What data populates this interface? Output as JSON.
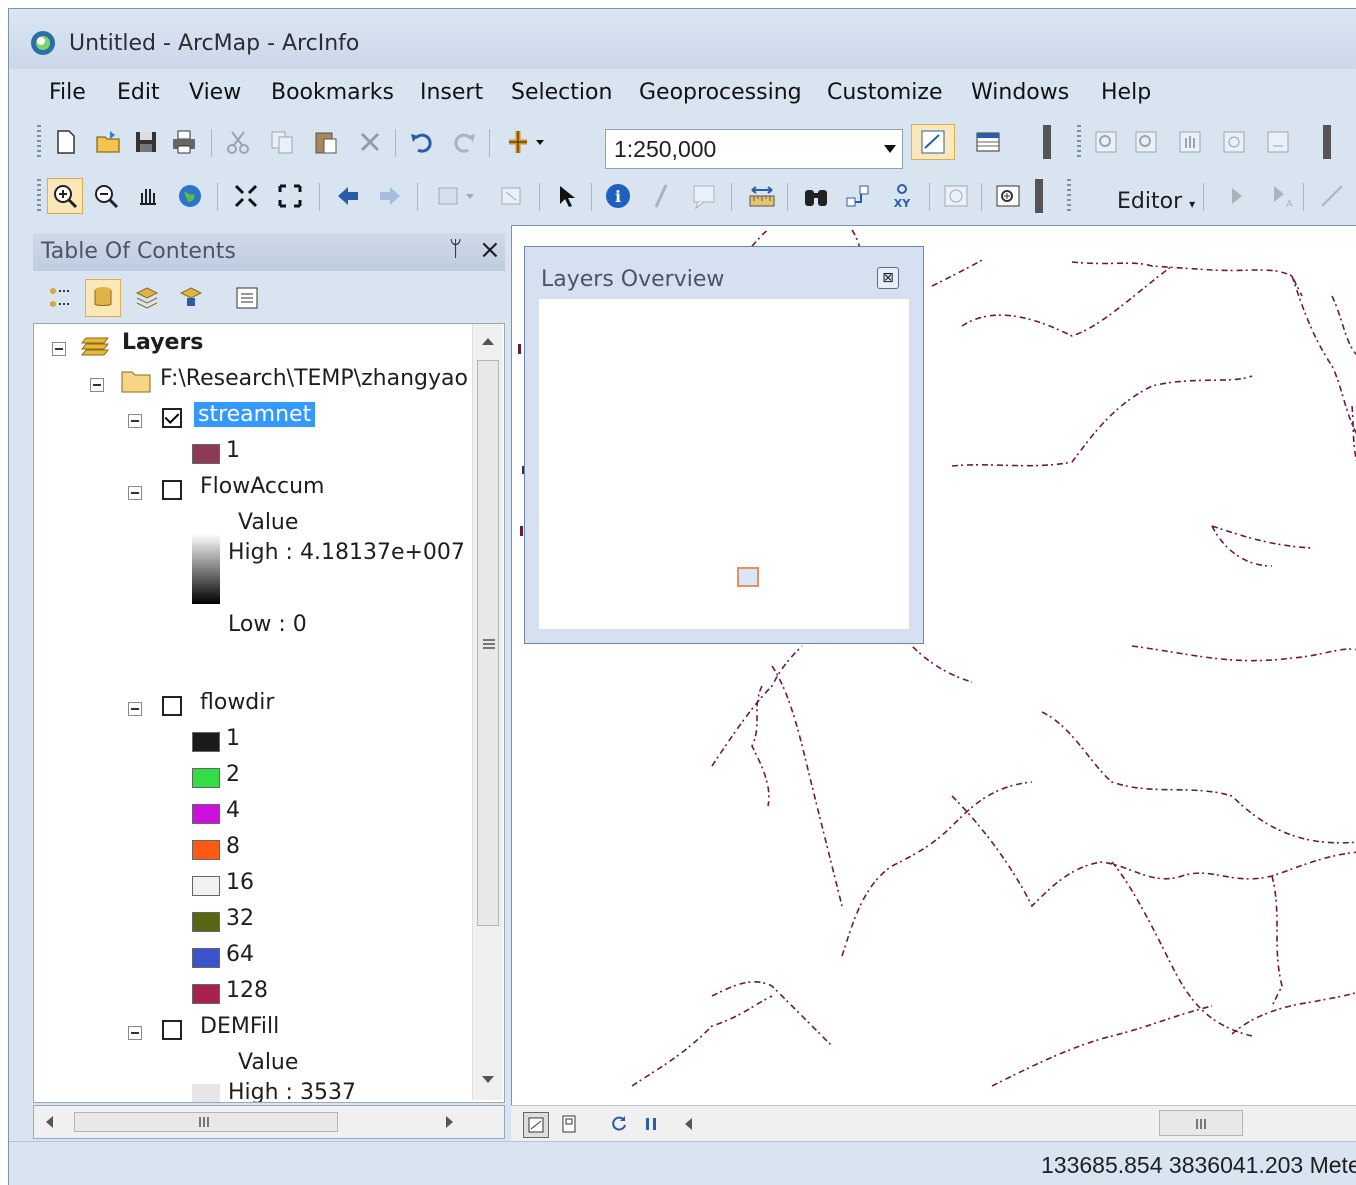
{
  "window": {
    "title": "Untitled - ArcMap - ArcInfo"
  },
  "menu": [
    "File",
    "Edit",
    "View",
    "Bookmarks",
    "Insert",
    "Selection",
    "Geoprocessing",
    "Customize",
    "Windows",
    "Help"
  ],
  "toolbar": {
    "scale_value": "1:250,000",
    "editor_label": "Editor",
    "icons_row1": [
      "new-document-icon",
      "open-folder-icon",
      "save-icon",
      "print-icon",
      "cut-icon",
      "copy-icon",
      "paste-icon",
      "delete-icon",
      "undo-icon",
      "redo-icon",
      "add-data-icon",
      "data-frame-tools-icon",
      "table-icon"
    ],
    "icons_row2": [
      "zoom-in-icon",
      "zoom-out-icon",
      "pan-icon",
      "full-extent-icon",
      "fixed-zoom-in-icon",
      "fixed-zoom-out-icon",
      "back-icon",
      "forward-icon",
      "select-features-icon",
      "clear-selection-icon",
      "select-elements-icon",
      "identify-icon",
      "hyperlink-icon",
      "html-popup-icon",
      "measure-icon",
      "find-icon",
      "find-route-icon",
      "go-to-xy-icon",
      "time-slider-icon",
      "overview-window-icon"
    ]
  },
  "toc": {
    "title": "Table Of Contents",
    "root_label": "Layers",
    "folder_label": "F:\\Research\\TEMP\\zhangyao",
    "layers": {
      "streamnet": {
        "name": "streamnet",
        "checked": true,
        "classes": [
          {
            "label": "1",
            "color": "#8c3a55"
          }
        ]
      },
      "flowaccum": {
        "name": "FlowAccum",
        "checked": false,
        "value_label": "Value",
        "high": "High : 4.18137e+007",
        "low": "Low : 0"
      },
      "flowdir": {
        "name": "flowdir",
        "checked": false,
        "classes": [
          {
            "label": "1",
            "color": "#1a1a1a"
          },
          {
            "label": "2",
            "color": "#33dd44"
          },
          {
            "label": "4",
            "color": "#cc11dd"
          },
          {
            "label": "8",
            "color": "#ff5a14"
          },
          {
            "label": "16",
            "color": "#f2f2f2"
          },
          {
            "label": "32",
            "color": "#5a6614"
          },
          {
            "label": "64",
            "color": "#3a55cc"
          },
          {
            "label": "128",
            "color": "#a8224e"
          }
        ]
      },
      "demfill": {
        "name": "DEMFill",
        "checked": false,
        "value_label": "Value",
        "high": "High : 3537"
      }
    }
  },
  "overview": {
    "title": "Layers Overview"
  },
  "status": {
    "coordinates": "133685.854  3836041.203 Mete"
  }
}
